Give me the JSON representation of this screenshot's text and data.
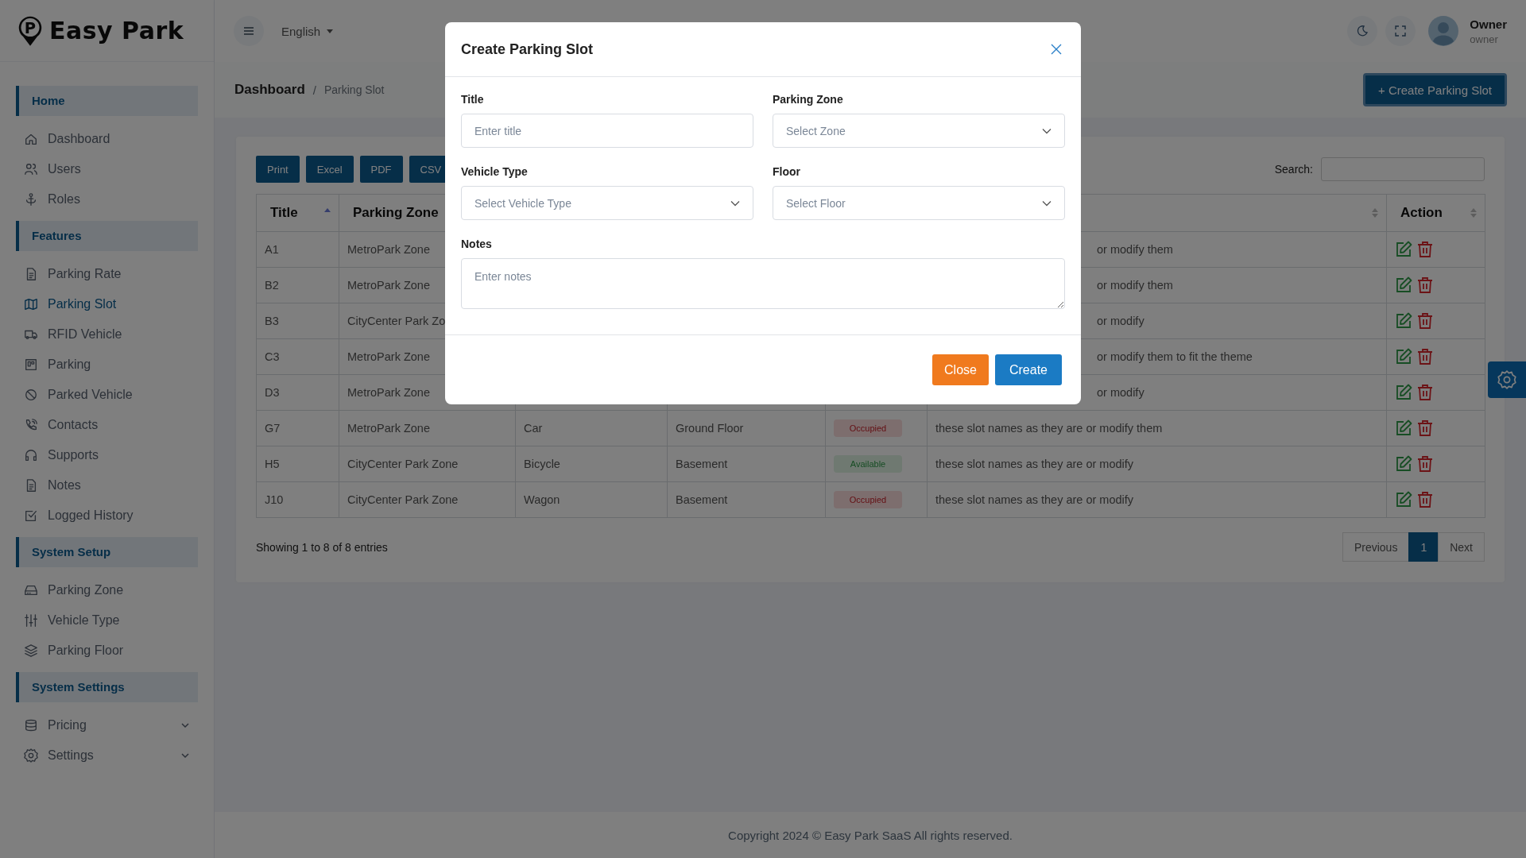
{
  "brand": {
    "mark": "P",
    "name": "Easy Park"
  },
  "sidebar": {
    "sections": [
      {
        "title": "Home",
        "items": [
          {
            "label": "Dashboard",
            "selected": false
          },
          {
            "label": "Users",
            "selected": false
          },
          {
            "label": "Roles",
            "selected": false
          }
        ]
      },
      {
        "title": "Features",
        "items": [
          {
            "label": "Parking Rate",
            "selected": false
          },
          {
            "label": "Parking Slot",
            "selected": true
          },
          {
            "label": "RFID Vehicle",
            "selected": false
          },
          {
            "label": "Parking",
            "selected": false
          },
          {
            "label": "Parked Vehicle",
            "selected": false
          },
          {
            "label": "Contacts",
            "selected": false
          },
          {
            "label": "Supports",
            "selected": false
          },
          {
            "label": "Notes",
            "selected": false
          },
          {
            "label": "Logged History",
            "selected": false
          }
        ]
      },
      {
        "title": "System Setup",
        "items": [
          {
            "label": "Parking Zone",
            "selected": false
          },
          {
            "label": "Vehicle Type",
            "selected": false
          },
          {
            "label": "Parking Floor",
            "selected": false
          }
        ]
      },
      {
        "title": "System Settings",
        "items": [
          {
            "label": "Pricing",
            "selected": false,
            "kind": "group",
            "expanded": false
          },
          {
            "label": "Settings",
            "selected": false,
            "kind": "group",
            "expanded": false
          }
        ]
      }
    ]
  },
  "topbar": {
    "language": "English",
    "user": {
      "name": "Owner",
      "role": "owner"
    }
  },
  "breadcrumb": {
    "separator": "/",
    "items": [
      {
        "label": "Dashboard"
      },
      {
        "label": "Parking Slot"
      }
    ]
  },
  "create_button": {
    "label": "Create Parking Slot",
    "icon": "+"
  },
  "export_buttons": [
    "Print",
    "Excel",
    "PDF",
    "CSV"
  ],
  "search": {
    "label": "Search:"
  },
  "table": {
    "columns": [
      {
        "label": "Title",
        "sorted": true
      },
      {
        "label": "Parking Zone"
      },
      {},
      {},
      {},
      {
        "sorted": false
      },
      {
        "label": "Action",
        "sorted": false
      }
    ],
    "rows": [
      {
        "title": "A1",
        "zone": "MetroPark Zone",
        "notes": "or modify them"
      },
      {
        "title": "B2",
        "zone": "MetroPark Zone",
        "notes": "or modify them"
      },
      {
        "title": "B3",
        "zone": "CityCenter Park Zo",
        "notes": "or modify"
      },
      {
        "title": "C3",
        "zone": "MetroPark Zone",
        "notes": "or modify them to fit the theme"
      },
      {
        "title": "D3",
        "zone": "MetroPark Zone",
        "notes": "or modify"
      },
      {
        "title": "G7",
        "zone": "MetroPark Zone",
        "vehicle_type": "Car",
        "floor": "Ground Floor",
        "status": {
          "label": "Occupied",
          "kind": "occupied"
        },
        "notes": "these slot names as they are or modify them"
      },
      {
        "title": "H5",
        "zone": "CityCenter Park Zone",
        "vehicle_type": "Bicycle",
        "floor": "Basement",
        "status": {
          "label": "Available",
          "kind": "available"
        },
        "notes": "these slot names as they are or modify"
      },
      {
        "title": "J10",
        "zone": "CityCenter Park Zone",
        "vehicle_type": "Wagon",
        "floor": "Basement",
        "status": {
          "label": "Occupied",
          "kind": "occupied"
        },
        "notes": "these slot names as they are or modify"
      }
    ]
  },
  "table_info": "Showing 1 to 8 of 8 entries",
  "pagination": [
    {
      "label": "Previous",
      "selected": false
    },
    {
      "label": "1",
      "selected": true
    },
    {
      "label": "Next",
      "selected": false
    }
  ],
  "footer": "Copyright 2024 © Easy Park SaaS All rights reserved.",
  "modal": {
    "title": "Create Parking Slot",
    "fields": [
      {
        "label": "Title",
        "kind": "text",
        "placeholder": "Enter title"
      },
      {
        "label": "Parking Zone",
        "kind": "select",
        "placeholder": "Select Zone"
      },
      {
        "label": "Vehicle Type",
        "kind": "select",
        "placeholder": "Select Vehicle Type"
      },
      {
        "label": "Floor",
        "kind": "select",
        "placeholder": "Select Floor"
      },
      {
        "label": "Notes",
        "kind": "textarea",
        "placeholder": "Enter notes"
      }
    ],
    "buttons": [
      {
        "label": "Close",
        "kind": "secondary"
      },
      {
        "label": "Create",
        "kind": "primary"
      }
    ]
  }
}
